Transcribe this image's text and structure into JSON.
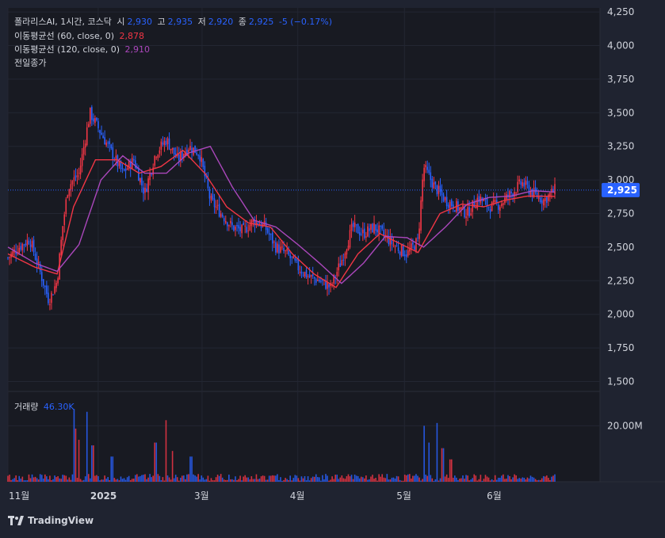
{
  "legend": {
    "symbol": "폴라리스AI, 1시간, 코스닥",
    "open_label": "시",
    "open_value": "2,930",
    "high_label": "고",
    "high_value": "2,935",
    "low_label": "저",
    "low_value": "2,920",
    "close_label": "종",
    "close_value": "2,925",
    "change": "-5 (−0.17%)",
    "ma60_label": "이동평균선 (60, close, 0)",
    "ma60_value": "2,878",
    "ma120_label": "이동평균선 (120, close, 0)",
    "ma120_value": "2,910",
    "prev_close_label": "전일종가",
    "volume_label": "거래량",
    "volume_value": "46.30K"
  },
  "brand": "TradingView",
  "colors": {
    "up": "#f23645",
    "down": "#2962ff",
    "ma60": "#f23645",
    "ma120": "#ab47bc",
    "text": "#d1d4dc",
    "background": "#1f2330",
    "plot_bg": "#181a22"
  },
  "chart_data": [
    {
      "type": "candlestick",
      "ylim": [
        1450,
        4280
      ],
      "y_ticks": [
        "4,250",
        "4,000",
        "3,750",
        "3,500",
        "3,250",
        "3,000",
        "2,750",
        "2,500",
        "2,250",
        "2,000",
        "1,750",
        "1,500"
      ],
      "y_tick_values": [
        4250,
        4000,
        3750,
        3500,
        3250,
        3000,
        2750,
        2500,
        2250,
        2000,
        1750,
        1500
      ],
      "x_ticks": [
        "11월",
        "2025",
        "3월",
        "4월",
        "5월",
        "6월"
      ],
      "x_tick_index": [
        0,
        0.165,
        0.355,
        0.53,
        0.725,
        0.89
      ],
      "last_price": 2925,
      "last_price_label": "2,925",
      "price_series": [
        {
          "t": 0.0,
          "v": 2420
        },
        {
          "t": 0.02,
          "v": 2500
        },
        {
          "t": 0.04,
          "v": 2560
        },
        {
          "t": 0.06,
          "v": 2300
        },
        {
          "t": 0.075,
          "v": 2100
        },
        {
          "t": 0.09,
          "v": 2250
        },
        {
          "t": 0.1,
          "v": 2650
        },
        {
          "t": 0.11,
          "v": 2950
        },
        {
          "t": 0.13,
          "v": 3050
        },
        {
          "t": 0.15,
          "v": 3500
        },
        {
          "t": 0.17,
          "v": 3350
        },
        {
          "t": 0.19,
          "v": 3200
        },
        {
          "t": 0.21,
          "v": 3050
        },
        {
          "t": 0.23,
          "v": 3150
        },
        {
          "t": 0.25,
          "v": 2900
        },
        {
          "t": 0.27,
          "v": 3200
        },
        {
          "t": 0.29,
          "v": 3300
        },
        {
          "t": 0.31,
          "v": 3150
        },
        {
          "t": 0.33,
          "v": 3250
        },
        {
          "t": 0.35,
          "v": 3200
        },
        {
          "t": 0.37,
          "v": 2850
        },
        {
          "t": 0.39,
          "v": 2750
        },
        {
          "t": 0.41,
          "v": 2650
        },
        {
          "t": 0.43,
          "v": 2620
        },
        {
          "t": 0.45,
          "v": 2700
        },
        {
          "t": 0.47,
          "v": 2650
        },
        {
          "t": 0.49,
          "v": 2500
        },
        {
          "t": 0.51,
          "v": 2450
        },
        {
          "t": 0.53,
          "v": 2350
        },
        {
          "t": 0.55,
          "v": 2280
        },
        {
          "t": 0.57,
          "v": 2250
        },
        {
          "t": 0.59,
          "v": 2200
        },
        {
          "t": 0.61,
          "v": 2400
        },
        {
          "t": 0.63,
          "v": 2650
        },
        {
          "t": 0.65,
          "v": 2600
        },
        {
          "t": 0.67,
          "v": 2650
        },
        {
          "t": 0.69,
          "v": 2580
        },
        {
          "t": 0.71,
          "v": 2500
        },
        {
          "t": 0.73,
          "v": 2450
        },
        {
          "t": 0.75,
          "v": 2550
        },
        {
          "t": 0.76,
          "v": 3100
        },
        {
          "t": 0.78,
          "v": 2950
        },
        {
          "t": 0.8,
          "v": 2850
        },
        {
          "t": 0.82,
          "v": 2800
        },
        {
          "t": 0.84,
          "v": 2750
        },
        {
          "t": 0.86,
          "v": 2870
        },
        {
          "t": 0.88,
          "v": 2800
        },
        {
          "t": 0.9,
          "v": 2820
        },
        {
          "t": 0.92,
          "v": 2900
        },
        {
          "t": 0.94,
          "v": 2980
        },
        {
          "t": 0.96,
          "v": 2900
        },
        {
          "t": 0.98,
          "v": 2850
        },
        {
          "t": 1.0,
          "v": 2925
        }
      ],
      "ma60": [
        {
          "t": 0.0,
          "v": 2450
        },
        {
          "t": 0.05,
          "v": 2350
        },
        {
          "t": 0.09,
          "v": 2300
        },
        {
          "t": 0.12,
          "v": 2800
        },
        {
          "t": 0.16,
          "v": 3150
        },
        {
          "t": 0.2,
          "v": 3150
        },
        {
          "t": 0.24,
          "v": 3050
        },
        {
          "t": 0.28,
          "v": 3100
        },
        {
          "t": 0.32,
          "v": 3220
        },
        {
          "t": 0.36,
          "v": 3050
        },
        {
          "t": 0.4,
          "v": 2800
        },
        {
          "t": 0.44,
          "v": 2680
        },
        {
          "t": 0.48,
          "v": 2650
        },
        {
          "t": 0.52,
          "v": 2450
        },
        {
          "t": 0.56,
          "v": 2300
        },
        {
          "t": 0.6,
          "v": 2200
        },
        {
          "t": 0.64,
          "v": 2450
        },
        {
          "t": 0.68,
          "v": 2600
        },
        {
          "t": 0.72,
          "v": 2520
        },
        {
          "t": 0.75,
          "v": 2460
        },
        {
          "t": 0.79,
          "v": 2750
        },
        {
          "t": 0.83,
          "v": 2820
        },
        {
          "t": 0.87,
          "v": 2800
        },
        {
          "t": 0.91,
          "v": 2850
        },
        {
          "t": 0.95,
          "v": 2880
        },
        {
          "t": 1.0,
          "v": 2878
        }
      ],
      "ma120": [
        {
          "t": 0.0,
          "v": 2500
        },
        {
          "t": 0.05,
          "v": 2380
        },
        {
          "t": 0.09,
          "v": 2320
        },
        {
          "t": 0.13,
          "v": 2520
        },
        {
          "t": 0.17,
          "v": 3000
        },
        {
          "t": 0.21,
          "v": 3180
        },
        {
          "t": 0.25,
          "v": 3050
        },
        {
          "t": 0.29,
          "v": 3050
        },
        {
          "t": 0.33,
          "v": 3200
        },
        {
          "t": 0.37,
          "v": 3250
        },
        {
          "t": 0.41,
          "v": 2950
        },
        {
          "t": 0.45,
          "v": 2700
        },
        {
          "t": 0.49,
          "v": 2650
        },
        {
          "t": 0.53,
          "v": 2520
        },
        {
          "t": 0.57,
          "v": 2380
        },
        {
          "t": 0.61,
          "v": 2230
        },
        {
          "t": 0.65,
          "v": 2380
        },
        {
          "t": 0.69,
          "v": 2580
        },
        {
          "t": 0.73,
          "v": 2570
        },
        {
          "t": 0.76,
          "v": 2500
        },
        {
          "t": 0.8,
          "v": 2650
        },
        {
          "t": 0.84,
          "v": 2820
        },
        {
          "t": 0.88,
          "v": 2870
        },
        {
          "t": 0.92,
          "v": 2880
        },
        {
          "t": 0.96,
          "v": 2920
        },
        {
          "t": 1.0,
          "v": 2910
        }
      ]
    },
    {
      "type": "bar",
      "title": "거래량",
      "ylim": [
        0,
        32000000
      ],
      "y_ticks": [
        "20.00M"
      ],
      "y_tick_values": [
        20000000
      ],
      "spikes": [
        {
          "t": 0.12,
          "v": 26000000
        },
        {
          "t": 0.125,
          "v": 19000000
        },
        {
          "t": 0.13,
          "v": 15000000
        },
        {
          "t": 0.145,
          "v": 25000000
        },
        {
          "t": 0.155,
          "v": 13000000
        },
        {
          "t": 0.19,
          "v": 9000000
        },
        {
          "t": 0.27,
          "v": 14000000
        },
        {
          "t": 0.29,
          "v": 22000000
        },
        {
          "t": 0.3,
          "v": 11000000
        },
        {
          "t": 0.335,
          "v": 9000000
        },
        {
          "t": 0.76,
          "v": 20000000
        },
        {
          "t": 0.77,
          "v": 14000000
        },
        {
          "t": 0.785,
          "v": 21000000
        },
        {
          "t": 0.795,
          "v": 12000000
        },
        {
          "t": 0.81,
          "v": 8000000
        }
      ],
      "last_value": "46.30K"
    }
  ]
}
